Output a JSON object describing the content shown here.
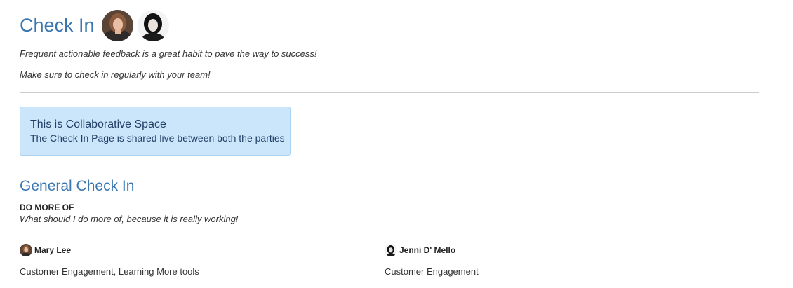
{
  "header": {
    "title": "Check In",
    "avatars": [
      {
        "icon": "avatar-mary-lee"
      },
      {
        "icon": "avatar-jenni-dmello"
      }
    ]
  },
  "intro": {
    "line1": "Frequent actionable feedback is a great habit to pave the way to success!",
    "line2": "Make sure to check in regularly with your team!"
  },
  "collab": {
    "title": "This is Collaborative Space",
    "subtitle": "The Check In Page is shared live between both the parties"
  },
  "section": {
    "title": "General Check In",
    "question_label": "DO MORE OF",
    "question_text": "What should I do more of, because it is really working!"
  },
  "responses": [
    {
      "name": "Mary Lee",
      "answer": "Customer Engagement, Learning More tools"
    },
    {
      "name": "Jenni D' Mello",
      "answer": "Customer Engagement"
    }
  ],
  "colors": {
    "accent": "#3a76b0",
    "info_bg": "#cbe5fb",
    "info_text": "#1f3f66"
  }
}
